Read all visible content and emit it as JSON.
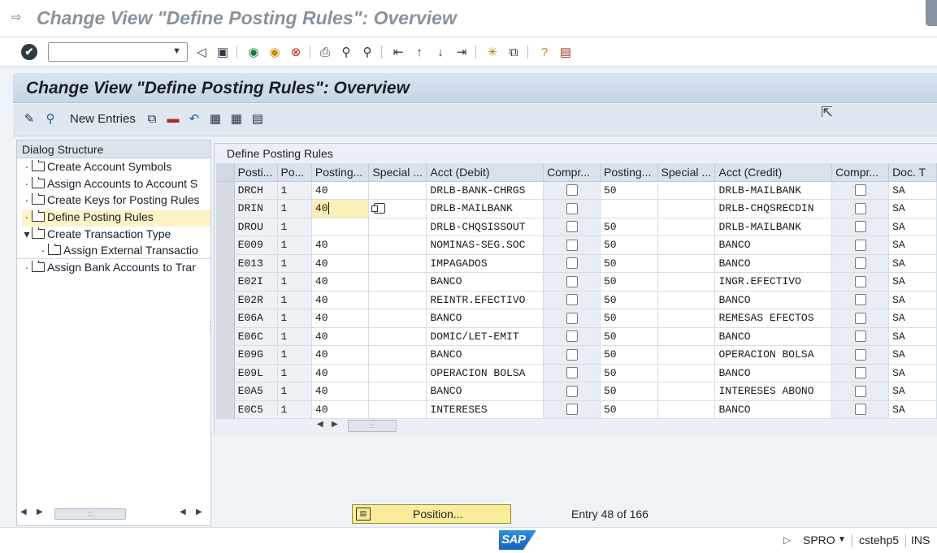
{
  "window": {
    "title": "Change View \"Define Posting Rules\": Overview"
  },
  "system_toolbar": {
    "command_field_value": "",
    "icons": [
      "enter-icon",
      "back-icon",
      "save-icon",
      "back-green-icon",
      "exit-icon",
      "cancel-icon",
      "print-icon",
      "find-icon",
      "find-next-icon",
      "first-page-icon",
      "prev-page-icon",
      "next-page-icon",
      "last-page-icon",
      "new-session-icon",
      "shortcut-icon",
      "help-icon",
      "layout-icon"
    ]
  },
  "screen": {
    "title": "Change View \"Define Posting Rules\": Overview"
  },
  "app_toolbar": {
    "new_entries_label": "New Entries",
    "icons": [
      "display-change-icon",
      "details-icon",
      "copy-icon",
      "delete-icon",
      "undo-icon",
      "select-all-icon",
      "select-block-icon",
      "deselect-all-icon"
    ]
  },
  "dialog_structure": {
    "title": "Dialog Structure",
    "items": [
      {
        "label": "Create Account Symbols",
        "level": 0,
        "bullet": "·",
        "selected": false
      },
      {
        "label": "Assign Accounts to Account S",
        "level": 0,
        "bullet": "·",
        "selected": false
      },
      {
        "label": "Create Keys for Posting Rules",
        "level": 0,
        "bullet": "·",
        "selected": false
      },
      {
        "label": "Define Posting Rules",
        "level": 0,
        "bullet": "·",
        "selected": true
      },
      {
        "label": "Create Transaction Type",
        "level": 0,
        "bullet": "▾",
        "selected": false
      },
      {
        "label": "Assign External Transactio",
        "level": 1,
        "bullet": "·",
        "selected": false
      },
      {
        "label": "Assign Bank Accounts to Trar",
        "level": 0,
        "bullet": "·",
        "selected": false
      }
    ]
  },
  "table": {
    "title": "Define Posting Rules",
    "columns": [
      "Posti...",
      "Po...",
      "Posting...",
      "Special ...",
      "Acct (Debit)",
      "Compr...",
      "Posting...",
      "Special ...",
      "Acct (Credit)",
      "Compr...",
      "Doc. T"
    ],
    "rows": [
      [
        "DRCH",
        "1",
        "40",
        "",
        "DRLB-BANK-CHRGS",
        "",
        "50",
        "",
        "DRLB-MAILBANK",
        "",
        "SA"
      ],
      [
        "DRIN",
        "1",
        "40",
        "",
        "DRLB-MAILBANK",
        "",
        "",
        "",
        "DRLB-CHQSRECDIN",
        "",
        "SA"
      ],
      [
        "DROU",
        "1",
        "",
        "",
        "DRLB-CHQSISSOUT",
        "",
        "50",
        "",
        "DRLB-MAILBANK",
        "",
        "SA"
      ],
      [
        "E009",
        "1",
        "40",
        "",
        "NOMINAS-SEG.SOC",
        "",
        "50",
        "",
        "BANCO",
        "",
        "SA"
      ],
      [
        "E013",
        "1",
        "40",
        "",
        "IMPAGADOS",
        "",
        "50",
        "",
        "BANCO",
        "",
        "SA"
      ],
      [
        "E02I",
        "1",
        "40",
        "",
        "BANCO",
        "",
        "50",
        "",
        "INGR.EFECTIVO",
        "",
        "SA"
      ],
      [
        "E02R",
        "1",
        "40",
        "",
        "REINTR.EFECTIVO",
        "",
        "50",
        "",
        "BANCO",
        "",
        "SA"
      ],
      [
        "E06A",
        "1",
        "40",
        "",
        "BANCO",
        "",
        "50",
        "",
        "REMESAS EFECTOS",
        "",
        "SA"
      ],
      [
        "E06C",
        "1",
        "40",
        "",
        "DOMIC/LET-EMIT",
        "",
        "50",
        "",
        "BANCO",
        "",
        "SA"
      ],
      [
        "E09G",
        "1",
        "40",
        "",
        "BANCO",
        "",
        "50",
        "",
        "OPERACION BOLSA",
        "",
        "SA"
      ],
      [
        "E09L",
        "1",
        "40",
        "",
        "OPERACION BOLSA",
        "",
        "50",
        "",
        "BANCO",
        "",
        "SA"
      ],
      [
        "E0A5",
        "1",
        "40",
        "",
        "BANCO",
        "",
        "50",
        "",
        "INTERESES ABONO",
        "",
        "SA"
      ],
      [
        "E0C5",
        "1",
        "40",
        "",
        "INTERESES",
        "",
        "50",
        "",
        "BANCO",
        "",
        "SA"
      ]
    ],
    "editing_row": 1,
    "editing_col": 2
  },
  "footer": {
    "position_label": "Position...",
    "entry_info": "Entry 48 of 166"
  },
  "status_bar": {
    "logo_text": "SAP",
    "transaction": "SPRO",
    "host": "cstehp5",
    "mode": "INS"
  }
}
